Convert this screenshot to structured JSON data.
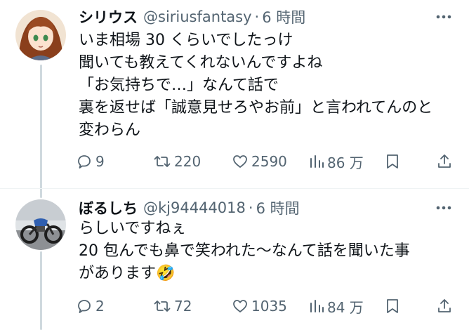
{
  "tweets": [
    {
      "display_name": "シリウス",
      "handle": "@siriusfantasy",
      "separator": "·",
      "time": "6 時間",
      "lines": [
        "いま相場 30 くらいでしたっけ",
        "聞いても教えてくれないんですよね",
        "「お気持ちで…」なんて話で",
        "裏を返せば「誠意見せろやお前」と言われてんのと",
        "変わらん"
      ],
      "metrics": {
        "replies": "9",
        "retweets": "220",
        "likes": "2590",
        "views": "86 万"
      }
    },
    {
      "display_name": "ぼるしち",
      "handle": "@kj94444018",
      "separator": "·",
      "time": "6 時間",
      "lines": [
        "らしいですねぇ",
        "20 包んでも鼻で笑われた〜なんて話を聞いた事",
        "があります"
      ],
      "emoji": "🤣",
      "metrics": {
        "replies": "2",
        "retweets": "72",
        "likes": "1035",
        "views": "84 万"
      }
    }
  ],
  "icons": {
    "more": "more-dots-icon",
    "reply": "reply-bubble-icon",
    "retweet": "retweet-icon",
    "like": "heart-icon",
    "views": "bar-chart-icon",
    "bookmark": "bookmark-icon",
    "share": "share-upload-icon"
  },
  "colors": {
    "text": "#0f1419",
    "secondary": "#536471",
    "thread_line": "#cfd9de"
  }
}
